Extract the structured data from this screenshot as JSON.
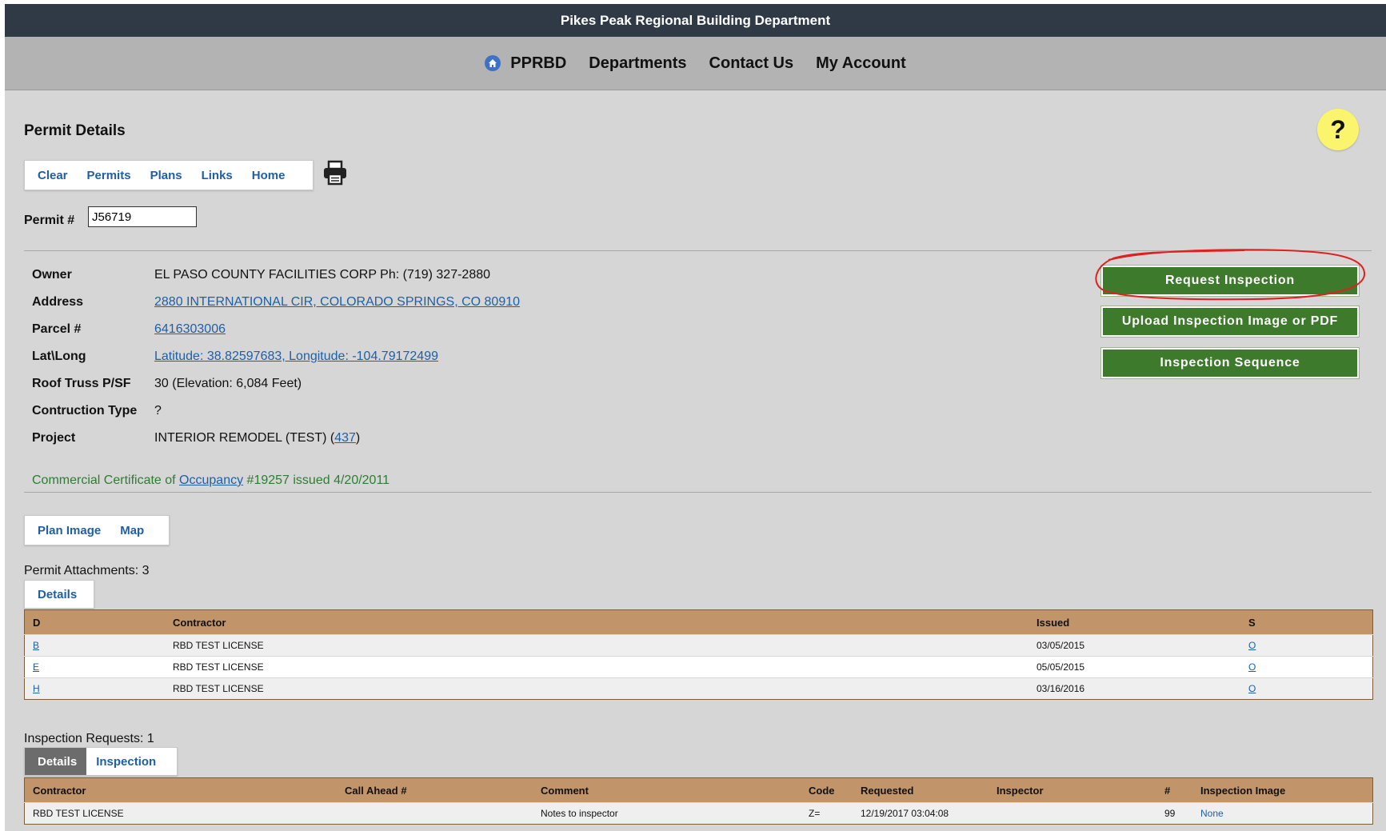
{
  "header": {
    "title": "Pikes Peak Regional Building Department"
  },
  "nav": {
    "home_label": "PPRBD",
    "items": [
      "Departments",
      "Contact Us",
      "My Account"
    ]
  },
  "page": {
    "title": "Permit Details",
    "help_label": "?"
  },
  "toolbar": {
    "tabs": [
      "Clear",
      "Permits",
      "Plans",
      "Links",
      "Home"
    ]
  },
  "permit": {
    "label": "Permit #",
    "value": "J56719"
  },
  "details": {
    "owner_label": "Owner",
    "owner": "EL PASO COUNTY FACILITIES CORP Ph: (719) 327-2880",
    "address_label": "Address",
    "address": "2880 INTERNATIONAL CIR, COLORADO SPRINGS, CO 80910",
    "parcel_label": "Parcel #",
    "parcel": "6416303006",
    "latlong_label": "Lat\\Long",
    "latlong": "Latitude: 38.82597683, Longitude: -104.79172499",
    "roof_label": "Roof Truss P/SF",
    "roof": "30 (Elevation: 6,084 Feet)",
    "construction_label": "Contruction Type",
    "construction": "?",
    "project_label": "Project",
    "project": "INTERIOR REMODEL (TEST) (",
    "project_link": "437",
    "project_close": ")"
  },
  "certificate": {
    "prefix": "Commercial Certificate of ",
    "link": "Occupancy",
    "suffix": " #19257 issued 4/20/2011"
  },
  "actions": {
    "request": "Request Inspection",
    "upload": "Upload Inspection Image or PDF",
    "sequence": "Inspection Sequence"
  },
  "plan_tabs": [
    "Plan Image",
    "Map"
  ],
  "attachments": {
    "label": "Permit Attachments: 3",
    "tab": "Details",
    "columns": [
      "D",
      "Contractor",
      "Issued",
      "S"
    ],
    "rows": [
      {
        "d": "B",
        "contractor": "RBD TEST LICENSE",
        "issued": "03/05/2015",
        "s": "O"
      },
      {
        "d": "E",
        "contractor": "RBD TEST LICENSE",
        "issued": "05/05/2015",
        "s": "O"
      },
      {
        "d": "H",
        "contractor": "RBD TEST LICENSE",
        "issued": "03/16/2016",
        "s": "O"
      }
    ]
  },
  "inspections": {
    "label": "Inspection Requests: 1",
    "tabs": [
      "Details",
      "Inspection"
    ],
    "columns": [
      "Contractor",
      "Call Ahead #",
      "Comment",
      "Code",
      "Requested",
      "Inspector",
      "#",
      "Inspection Image"
    ],
    "rows": [
      {
        "contractor": "RBD TEST LICENSE",
        "call_ahead": "",
        "comment": "Notes to inspector",
        "code": "Z=",
        "requested": "12/19/2017 03:04:08",
        "inspector": "",
        "num": "99",
        "image": "None"
      }
    ]
  },
  "colors": {
    "topbar": "#2f3a46",
    "navbar": "#b3b3b3",
    "action_green": "#3e7a2b",
    "table_header": "#c1946a",
    "link": "#1f5fa6",
    "annotation": "#e02020"
  }
}
